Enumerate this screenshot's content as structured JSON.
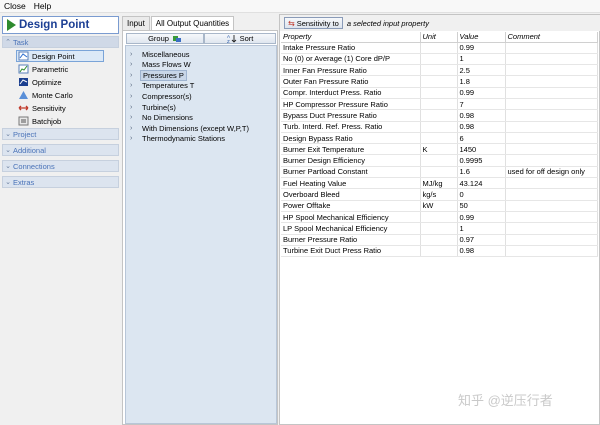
{
  "menu": [
    "Close",
    "Help"
  ],
  "left": {
    "title": "Design Point",
    "groups": {
      "task": "Task",
      "project": "Project",
      "additional": "Additional",
      "connections": "Connections",
      "extras": "Extras"
    },
    "task_items": [
      {
        "label": "Design Point",
        "icon": "design-point-icon",
        "selected": true
      },
      {
        "label": "Parametric",
        "icon": "parametric-icon",
        "selected": false
      },
      {
        "label": "Optimize",
        "icon": "optimize-icon",
        "selected": false
      },
      {
        "label": "Monte Carlo",
        "icon": "monte-carlo-icon",
        "selected": false
      },
      {
        "label": "Sensitivity",
        "icon": "sensitivity-icon",
        "selected": false
      },
      {
        "label": "Batchjob",
        "icon": "batchjob-icon",
        "selected": false
      }
    ]
  },
  "middle": {
    "tabs": [
      "Input",
      "All Output Quantities"
    ],
    "active_tab": "All Output Quantities",
    "group_label": "Group",
    "sort_label": "Sort",
    "tree": [
      {
        "label": "Miscellaneous",
        "selected": false
      },
      {
        "label": "Mass Flows W",
        "selected": false
      },
      {
        "label": "Pressures P",
        "selected": true
      },
      {
        "label": "Temperatures T",
        "selected": false
      },
      {
        "label": "Compressor(s)",
        "selected": false
      },
      {
        "label": "Turbine(s)",
        "selected": false
      },
      {
        "label": "No Dimensions",
        "selected": false
      },
      {
        "label": "With Dimensions (except W,P,T)",
        "selected": false
      },
      {
        "label": "Thermodynamic Stations",
        "selected": false
      }
    ]
  },
  "right": {
    "sensitivity_button": "Sensitivity to",
    "sensitivity_text": "a selected input property",
    "columns": [
      "Property",
      "Unit",
      "Value",
      "Comment"
    ],
    "rows": [
      [
        "Intake Pressure Ratio",
        "",
        "0.99",
        ""
      ],
      [
        "No (0) or Average (1) Core dP/P",
        "",
        "1",
        ""
      ],
      [
        "Inner Fan Pressure Ratio",
        "",
        "2.5",
        ""
      ],
      [
        "Outer Fan Pressure Ratio",
        "",
        "1.8",
        ""
      ],
      [
        "Compr. Interduct Press. Ratio",
        "",
        "0.99",
        ""
      ],
      [
        "HP Compressor Pressure Ratio",
        "",
        "7",
        ""
      ],
      [
        "Bypass Duct Pressure Ratio",
        "",
        "0.98",
        ""
      ],
      [
        "Turb. Interd. Ref. Press. Ratio",
        "",
        "0.98",
        ""
      ],
      [
        "Design Bypass Ratio",
        "",
        "6",
        ""
      ],
      [
        "Burner Exit Temperature",
        "K",
        "1450",
        ""
      ],
      [
        "Burner Design Efficiency",
        "",
        "0.9995",
        ""
      ],
      [
        "Burner Partload Constant",
        "",
        "1.6",
        "used for off design only"
      ],
      [
        "Fuel Heating Value",
        "MJ/kg",
        "43.124",
        ""
      ],
      [
        "Overboard Bleed",
        "kg/s",
        "0",
        ""
      ],
      [
        "Power Offtake",
        "kW",
        "50",
        ""
      ],
      [
        "HP Spool Mechanical Efficiency",
        "",
        "0.99",
        ""
      ],
      [
        "LP Spool Mechanical Efficiency",
        "",
        "1",
        ""
      ],
      [
        "Burner Pressure Ratio",
        "",
        "0.97",
        ""
      ],
      [
        "Turbine Exit Duct Press Ratio",
        "",
        "0.98",
        ""
      ]
    ]
  },
  "watermark": "知乎 @逆压行者",
  "colors": {
    "title_text": "#1c3f94",
    "play_icon": "#2e8b2e",
    "group_header": "#dce4ef",
    "group_text": "#4a73b8",
    "tree_bg": "#dce6f1",
    "selection": "#dce9f7"
  }
}
